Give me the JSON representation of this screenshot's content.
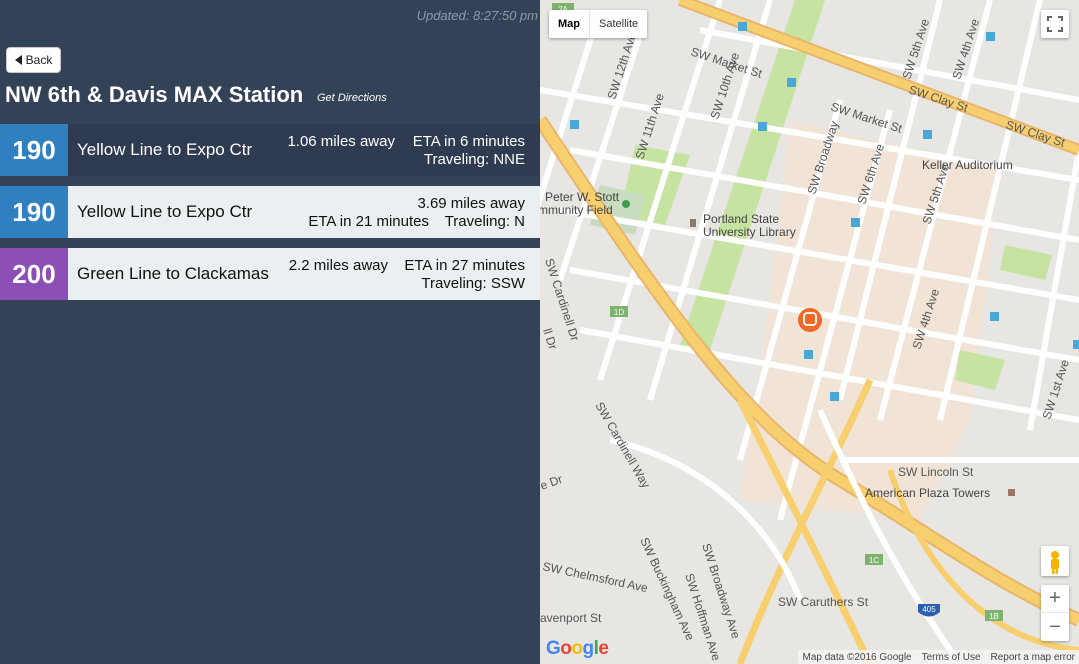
{
  "header": {
    "updated": "Updated: 8:27:50 pm",
    "back_label": "Back",
    "station_title": "NW 6th & Davis MAX Station",
    "directions_link": "Get Directions"
  },
  "arrivals": [
    {
      "route": "190",
      "color": "#2f7fc1",
      "name": "Yellow Line to Expo Ctr",
      "distance": "1.06 miles away",
      "eta": "ETA in 6 minutes",
      "traveling": "Traveling: NNE"
    },
    {
      "route": "190",
      "color": "#2f7fc1",
      "name": "Yellow Line to Expo Ctr",
      "distance": "3.69 miles away",
      "eta": "ETA in 21 minutes",
      "traveling": "Traveling: N"
    },
    {
      "route": "200",
      "color": "#8c4fb5",
      "name": "Green Line to Clackamas",
      "distance": "2.2 miles away",
      "eta": "ETA in 27 minutes",
      "traveling": "Traveling: SSW"
    }
  ],
  "map": {
    "type_map": "Map",
    "type_satellite": "Satellite",
    "zoom_in": "+",
    "zoom_out": "−",
    "logo": "Google",
    "attribution": "Map data ©2016 Google",
    "terms": "Terms of Use",
    "report": "Report a map error",
    "street_labels": {
      "market_1": "SW Market St",
      "market_2": "SW Market St",
      "clay_1": "SW Clay St",
      "clay_2": "SW Clay St",
      "sw12th": "SW 12th Ave",
      "sw11th": "SW 11th Ave",
      "sw10th": "SW 10th Ave",
      "broadway": "SW Broadway",
      "broadway_s": "SW Broadway Ave",
      "sw6th": "SW 6th Ave",
      "sw5th_n": "SW 5th Ave",
      "sw5th": "SW 5th Ave",
      "sw4th_n": "SW 4th Ave",
      "sw4th": "SW 4th Ave",
      "sw1st": "SW 1st Ave",
      "cardinell": "SW Cardinell Dr",
      "cardinell_way": "SW Cardinell Way",
      "lincoln": "SW Lincoln St",
      "caruthers": "SW Caruthers St",
      "chelmsford": "SW Chelmsford Ave",
      "buckingham": "SW Buckingham Ave",
      "hoffman": "SW Hoffman Ave",
      "davenport": "avenport St",
      "cardinell_edge": "ll Dr",
      "dr_edge": "e Dr"
    },
    "pois": {
      "stott": "Peter W. Stott",
      "stott2": "mmunity Field",
      "psu": "Portland State",
      "psu2": "University Library",
      "keller": "Keller Auditorium",
      "american": "American Plaza Towers"
    },
    "shields": {
      "s2a": "2A",
      "s1d": "1D",
      "s1c": "1C",
      "s1b": "1B",
      "i405": "405"
    },
    "colors": {
      "highway": "#f7cf6f",
      "park": "#c6e3a1",
      "campus": "#f1e4d6",
      "station": "#ee6a28"
    }
  }
}
